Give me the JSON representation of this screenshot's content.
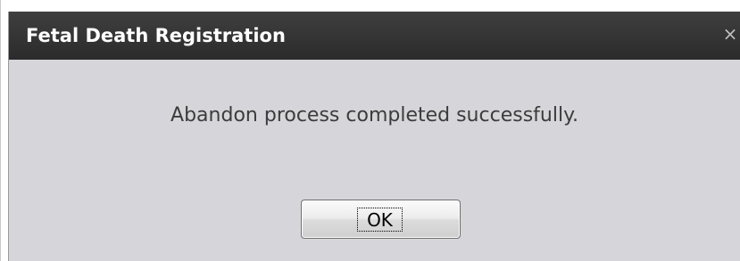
{
  "dialog": {
    "title": "Fetal Death Registration",
    "close_symbol": "×",
    "close_icon": "close-icon",
    "message": "Abandon process completed successfully.",
    "ok_label": "OK"
  },
  "colors": {
    "titlebar": "#2f2f2f",
    "title_text": "#ffffff",
    "dialog_body": "#d6d5d9",
    "message_text": "#3c3c3c"
  }
}
